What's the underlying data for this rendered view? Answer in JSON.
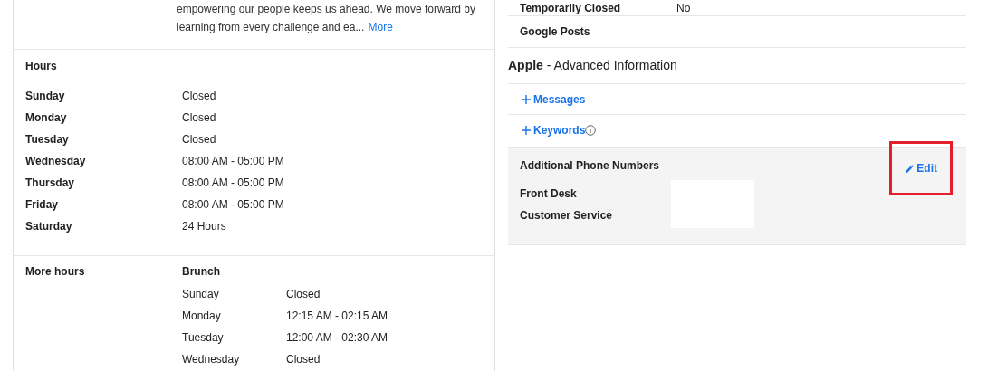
{
  "description": {
    "lines": [
      "empowering our people keeps us ahead. We move forward by",
      "learning from every challenge and ea..."
    ],
    "more_link": "More"
  },
  "hours": {
    "title": "Hours",
    "rows": [
      {
        "day": "Sunday",
        "time": "Closed"
      },
      {
        "day": "Monday",
        "time": "Closed"
      },
      {
        "day": "Tuesday",
        "time": "Closed"
      },
      {
        "day": "Wednesday",
        "time": "08:00 AM - 05:00 PM"
      },
      {
        "day": "Thursday",
        "time": "08:00 AM - 05:00 PM"
      },
      {
        "day": "Friday",
        "time": "08:00 AM - 05:00 PM"
      },
      {
        "day": "Saturday",
        "time": "24 Hours"
      }
    ]
  },
  "more_hours": {
    "title": "More hours",
    "groups": [
      {
        "name": "Brunch",
        "rows": [
          {
            "day": "Sunday",
            "time": "Closed"
          },
          {
            "day": "Monday",
            "time": "12:15 AM - 02:15 AM"
          },
          {
            "day": "Tuesday",
            "time": "12:00 AM - 02:30 AM"
          },
          {
            "day": "Wednesday",
            "time": "Closed"
          }
        ]
      }
    ]
  },
  "info_rows": [
    {
      "label": "Temporarily Closed",
      "value": "No"
    },
    {
      "label": "Google Posts"
    }
  ],
  "advanced": {
    "brand": "Apple",
    "title": " - Advanced Information",
    "links": [
      {
        "label": "Messages",
        "info": false
      },
      {
        "label": "Keywords",
        "info": true
      }
    ]
  },
  "phones": {
    "title": "Additional Phone Numbers",
    "edit": "Edit",
    "highlighted": true,
    "labels": [
      "Front Desk",
      "Customer Service"
    ]
  }
}
